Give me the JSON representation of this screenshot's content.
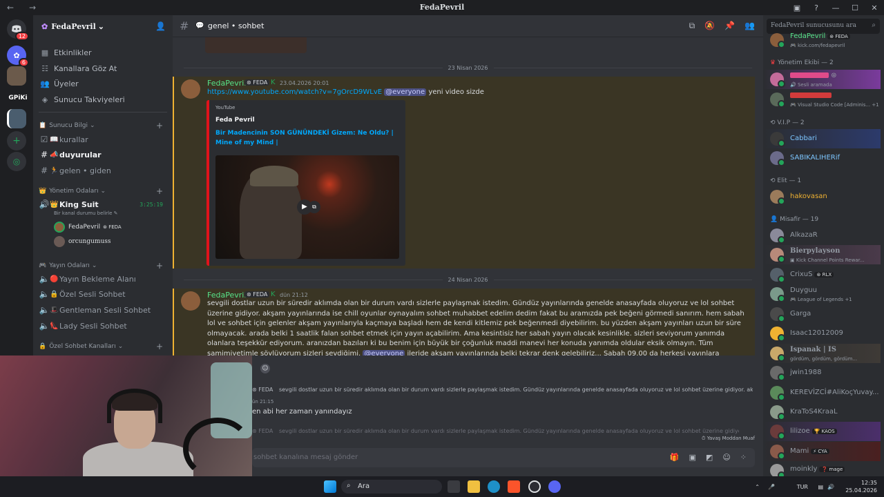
{
  "window": {
    "title": "FedaPevril",
    "back": "←",
    "forward": "→",
    "controls": [
      "▣",
      "?",
      "—",
      "☐",
      "✕"
    ]
  },
  "server": {
    "name": "FedaPevril",
    "chevron": "⌄",
    "tag_label": "GPiKi"
  },
  "servers_rail": [
    {
      "badge": "12"
    },
    {
      "badge": "6"
    },
    {
      "badge": ""
    }
  ],
  "sidebar": {
    "nav": [
      {
        "label": "Etkinlikler",
        "icon": "calendar-icon",
        "glyph": "▦"
      },
      {
        "label": "Kanallara Göz At",
        "icon": "browse-icon",
        "glyph": "☷"
      },
      {
        "label": "Üyeler",
        "icon": "members-icon",
        "glyph": "👥"
      },
      {
        "label": "Sunucu Takviyeleri",
        "icon": "boost-icon",
        "glyph": "◈"
      }
    ],
    "categories": [
      {
        "label": "Sunucu Bilgi",
        "channels": [
          {
            "name": "kurallar",
            "emoji": "📖",
            "active": false
          },
          {
            "name": "duyurular",
            "emoji": "📣",
            "active": true
          },
          {
            "name": "gelen • giden",
            "emoji": "🏃",
            "active": false
          }
        ]
      },
      {
        "label": "Yönetim Odaları"
      },
      {
        "label": "Yayın Odaları",
        "channels": [
          {
            "name": "Yayın Bekleme Alanı",
            "emoji": "🔴"
          },
          {
            "name": "Özel Sesli Sohbet",
            "emoji": "🔒"
          },
          {
            "name": "Gentleman Sesli Sohbet",
            "emoji": "🎩"
          },
          {
            "name": "Lady Sesli Sohbet",
            "emoji": "👠"
          }
        ]
      },
      {
        "label": "Özel Sohbet Kanalları"
      }
    ],
    "voice": {
      "channel": "King Suit",
      "timer": "3:25:19",
      "status_hint": "Bir kanal durumu belirle",
      "users": [
        "FedaPevril",
        "orcungumuss"
      ],
      "user_tag": "FEDA"
    }
  },
  "header": {
    "channel": "genel • sohbet"
  },
  "chat": {
    "dates": [
      "23 Nisan 2026",
      "24 Nisan 2026"
    ],
    "msg1": {
      "author": "FedaPevril",
      "tag": "FEDA",
      "time": "23.04.2026 20:01",
      "link": "https://www.youtube.com/watch?v=7gOrcD9WLvE",
      "mention": "@everyone",
      "text": "yeni video sizde",
      "embed_provider": "YouTube",
      "embed_author": "Feda Pevril",
      "embed_title": "Bir Madencinin SON GÜNÜNDEKİ Gizem: Ne Oldu? | Mine of my Mind |"
    },
    "msg2": {
      "author": "FedaPevril",
      "tag": "FEDA",
      "time": "dün 21:12",
      "text_a": "sevgili dostlar uzun bir süredir aklımda olan bir durum vardı sizlerle paylaşmak istedim. Gündüz yayınlarında genelde anasayfada oluyoruz ve lol sohbet üzerine gidiyor. akşam yayınlarında ise chill oyunlar oynayalım sohbet muhabbet edelim dedim fakat bu aramızda pek beğeni görmedi sanırım. hem sabah lol ve sohbet için gelenler akşam yayınlarıyla kaçmaya başladı hem de kendi kitlemiz pek beğenmedi diyebilirim. bu yüzden akşam yayınları uzun bir süre olmayacak. arada belki 1 saatlik falan sohbet etmek için yayın açabilirim. Ama kesintisiz her sabah yayın olacak kesinlikle. sizleri seviyorum yanımda olanlara teşekkür ediyorum. aranızdan bazıları ki bu benim için büyük bir çoğunluk maddi manevi her konuda yanımda oldular eksik olmayın. Tüm samimiyetimle söylüyorum sizleri sevdiğimi.",
      "mention": "@everyone",
      "text_b": "ileride akşam yayınlarında belki tekrar denk gelebiliriz... Sabah 09.00 da herkesi yayınlara beklerim."
    },
    "reply1": {
      "tag": "FEDA",
      "quote": "sevgili dostlar uzun bir süredir aklımda olan bir durum vardı sizlerle paylaşmak istedim. Gündüz yayınlarında genelde anasayfada oluyoruz ve lol sohbet üzerine gidiyor. ak...",
      "time": "ün 21:15",
      "text": "en abi her zaman yanındayız"
    },
    "reply2": {
      "tag": "FEDA",
      "quote": "sevgili dostlar uzun bir süredir aklımda olan bir durum vardı sizlerle paylaşmak istedim. Gündüz yayınlarında genelde anasayfada oluyoruz ve lol sohbet üzerine gidiyor. ak..."
    },
    "slowmode": "Yavaş Moddan Muaf",
    "composer_placeholder": "sohbet kanalına mesaj gönder"
  },
  "members": {
    "search_placeholder": "FedaPevril sunucusunu ara",
    "top_partial": {
      "name": "FedaPevril",
      "tag": "FEDA",
      "status": "kick.com/fedapevril"
    },
    "groups": [
      {
        "label": "Yönetim Ekibi — 2",
        "members": [
          {
            "name": "",
            "status": "Sesli aramada",
            "color": "#e14b8a"
          },
          {
            "name": "",
            "status": "Visual Studio Code [Adminis...",
            "extra": "+1",
            "color": "#d23b3b"
          }
        ]
      },
      {
        "label": "V.I.P — 2",
        "members": [
          {
            "name": "Cabbari",
            "color": "#7dc6ff"
          },
          {
            "name": "SABIKALIHERif",
            "color": "#7dc6ff"
          }
        ]
      },
      {
        "label": "Elit — 1",
        "members": [
          {
            "name": "hakovasan",
            "color": "#f0b232"
          }
        ]
      },
      {
        "label": "Misafir — 19",
        "members": [
          {
            "name": "AlkazaR",
            "color": "#b5bac1"
          },
          {
            "name": "Bierpylayson",
            "status": "Kick Channel Points Rewar...",
            "color": "#b5bac1"
          },
          {
            "name": "CrixuS",
            "tag": "RLX",
            "color": "#b5bac1"
          },
          {
            "name": "Duyguu",
            "status": "League of Legends",
            "extra": "+1",
            "color": "#b5bac1"
          },
          {
            "name": "Garga",
            "color": "#b5bac1"
          },
          {
            "name": "Isaac12012009",
            "color": "#b5bac1"
          },
          {
            "name": "Ispanak | IS",
            "status": "gördüm, gördüm, gördüm...",
            "color": "#b5bac1"
          },
          {
            "name": "jwin1988",
            "color": "#b5bac1"
          },
          {
            "name": "KEREVİZCİ#AliKoçYuvay...",
            "color": "#b5bac1"
          },
          {
            "name": "KraToS4KraaL",
            "color": "#b5bac1"
          },
          {
            "name": "lilizoe",
            "tag": "KAOS",
            "color": "#b5bac1"
          },
          {
            "name": "Mami",
            "tag": "CYA",
            "color": "#b5bac1"
          },
          {
            "name": "moinkly",
            "tag": "mage",
            "color": "#b5bac1"
          }
        ]
      }
    ]
  },
  "taskbar": {
    "search": "Ara",
    "lang": "TUR",
    "time": "12:35",
    "date": "25.04.2026"
  },
  "colors": {
    "accent_online": "#23a55a",
    "mention_bg": "#3a3524",
    "embed_bar": "#e1131b",
    "link": "#00a8fc",
    "username_green": "#57e389"
  }
}
